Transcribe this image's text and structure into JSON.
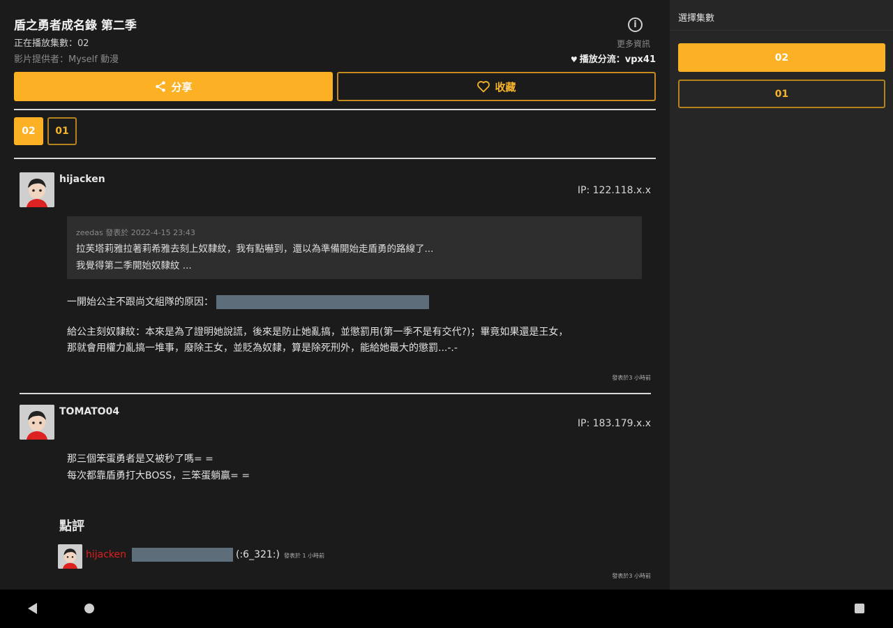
{
  "header": {
    "title": "盾之勇者成名錄 第二季",
    "now_playing": "正在播放集數：02",
    "provider": "影片提供者：Myself 動漫",
    "more_info": "更多資訊",
    "play_category": "播放分流：vpx41"
  },
  "actions": {
    "share_label": "分享",
    "favorite_label": "收藏"
  },
  "episodes": [
    "02",
    "01"
  ],
  "comments": [
    {
      "user": "hijacken",
      "ip": "IP: 122.118.x.x",
      "quote_meta": "zeedas 發表於 2022-4-15 23:43",
      "quote_line1": "拉芙塔莉雅拉著莉希雅去刻上奴隸紋，我有點嚇到，還以為準備開始走盾勇的路線了...",
      "quote_line2": "我覺得第二季開始奴隸紋 ...",
      "line1": "一開始公主不跟尚文組隊的原因：",
      "line2": "給公主刻奴隸紋：本來是為了證明她說謊，後來是防止她亂搞，並懲罰用(第一季不是有交代?)；畢竟如果還是王女，",
      "line3": "那就會用權力亂搞一堆事，廢除王女，並貶為奴隸，算是除死刑外，能給她最大的懲罰...-.-",
      "time": "發表於3 小時前"
    },
    {
      "user": "TOMATO04",
      "ip": "IP: 183.179.x.x",
      "line1": "那三個笨蛋勇者是又被秒了嗎= =",
      "line2": "每次都靠盾勇打大BOSS，三笨蛋躺贏= ="
    }
  ],
  "review": {
    "heading": "點評",
    "user": "hijacken",
    "score": "(:6_321:)",
    "time": "發表於 1 小時前",
    "footer_time": "發表於3 小時前"
  },
  "sidebar": {
    "title": "選擇集數",
    "episodes": [
      "02",
      "01"
    ]
  },
  "colors": {
    "accent": "#fbb123",
    "accent_border": "#b5821d",
    "background": "#1b1b1b",
    "sidebar": "#262626",
    "quote_bg": "#2e2e2e",
    "spoiler": "#5d6d7a",
    "review_user": "#e21d1d"
  },
  "icons": [
    "info-icon",
    "heart-icon",
    "share-icon",
    "heart-outline-icon",
    "avatar-icon",
    "back-icon",
    "home-icon",
    "recents-icon"
  ]
}
